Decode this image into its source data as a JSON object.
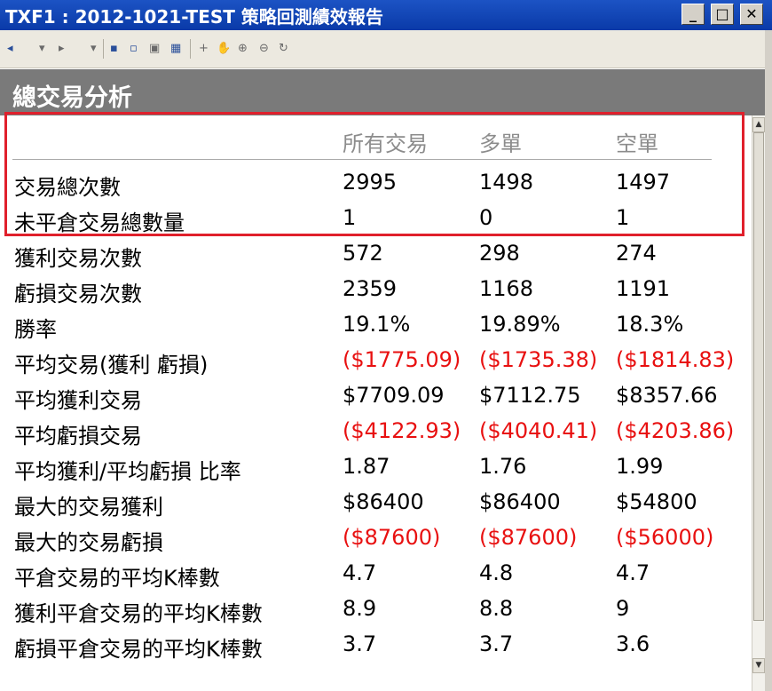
{
  "window": {
    "title": "TXF1 : 2012-1021-TEST 策略回測績效報告",
    "minimize": "_",
    "maximize": "□",
    "close": "✕"
  },
  "toolbar": {
    "back": "◂",
    "back_dd": "▾",
    "forward": "▸",
    "forward_dd": "▾",
    "save": "▪",
    "print_preview": "▫",
    "print": "▣",
    "layout": "▦",
    "crosshair": "+",
    "hand": "✋",
    "zoom_in": "⊕",
    "zoom_out": "⊖",
    "refresh": "↻"
  },
  "section": {
    "title": "總交易分析"
  },
  "table": {
    "headers": [
      "所有交易",
      "多單",
      "空單"
    ],
    "rows": [
      {
        "label": "交易總次數",
        "all": "2995",
        "long": "1498",
        "short": "1497",
        "negative": false
      },
      {
        "label": "未平倉交易總數量",
        "all": "1",
        "long": "0",
        "short": "1",
        "negative": false
      },
      {
        "label": "獲利交易次數",
        "all": "572",
        "long": "298",
        "short": "274",
        "negative": false
      },
      {
        "label": "虧損交易次數",
        "all": "2359",
        "long": "1168",
        "short": "1191",
        "negative": false
      },
      {
        "label": "勝率",
        "all": "19.1%",
        "long": "19.89%",
        "short": "18.3%",
        "negative": false
      },
      {
        "label": "平均交易(獲利  虧損)",
        "all": "($1775.09)",
        "long": "($1735.38)",
        "short": "($1814.83)",
        "negative": true
      },
      {
        "label": "平均獲利交易",
        "all": "$7709.09",
        "long": "$7112.75",
        "short": "$8357.66",
        "negative": false
      },
      {
        "label": "平均虧損交易",
        "all": "($4122.93)",
        "long": "($4040.41)",
        "short": "($4203.86)",
        "negative": true
      },
      {
        "label": "平均獲利/平均虧損  比率",
        "all": "1.87",
        "long": "1.76",
        "short": "1.99",
        "negative": false
      },
      {
        "label": "最大的交易獲利",
        "all": "$86400",
        "long": "$86400",
        "short": "$54800",
        "negative": false
      },
      {
        "label": "最大的交易虧損",
        "all": "($87600)",
        "long": "($87600)",
        "short": "($56000)",
        "negative": true
      },
      {
        "label": "平倉交易的平均K棒數",
        "all": "4.7",
        "long": "4.8",
        "short": "4.7",
        "negative": false
      },
      {
        "label": "獲利平倉交易的平均K棒數",
        "all": "8.9",
        "long": "8.8",
        "short": "9",
        "negative": false
      },
      {
        "label": "虧損平倉交易的平均K棒數",
        "all": "3.7",
        "long": "3.7",
        "short": "3.6",
        "negative": false
      }
    ]
  },
  "scrollbar": {
    "up": "▲",
    "down": "▼"
  },
  "colors": {
    "titlebar": "#0a3aa8",
    "negative": "#e81010",
    "highlight_box": "#e0202c",
    "section_bg": "#7a7a7a"
  }
}
